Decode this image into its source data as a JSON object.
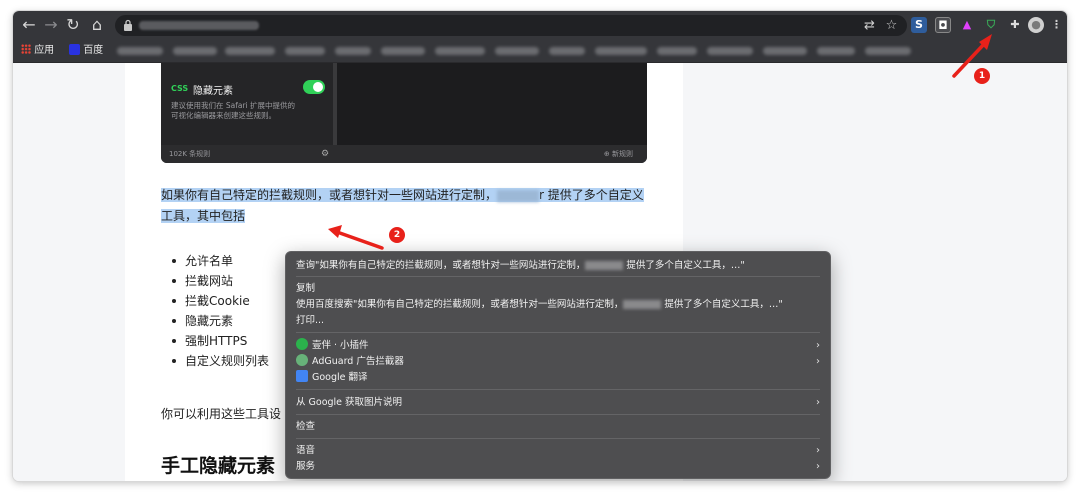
{
  "browser": {
    "extensions": [
      {
        "name": "s-extension-icon",
        "glyph": "S",
        "color": "#4a90d9"
      },
      {
        "name": "camera-extension-icon",
        "glyph": "◘",
        "color": "#5f6368"
      },
      {
        "name": "triangle-extension-icon",
        "glyph": "▲",
        "color": "#e040fb"
      },
      {
        "name": "adguard-extension-icon",
        "glyph": "⛉",
        "color": "#3aa757"
      },
      {
        "name": "puzzle-extension-icon",
        "glyph": "✚",
        "color": "#9aa0a6"
      }
    ],
    "bookmarks": {
      "apps_label": "应用",
      "baidu_label": "百度"
    }
  },
  "article": {
    "dark_panel": {
      "tag": "CSS",
      "title": "隐藏元素",
      "description": "建议使用我们在 Safari 扩展中提供的可视化编辑器来创建这些规则。",
      "count": "102K 条规则",
      "new_rule": "新规则"
    },
    "para1_part1": "如果你有自己特定的拦截规则，或者想针对一些网站进行定制，",
    "para1_part2": "r 提供了多个自定义工具，其中包括",
    "features": [
      "允许名单",
      "拦截网站",
      "拦截Cookie",
      "隐藏元素",
      "强制HTTPS",
      "自定义规则列表"
    ],
    "para2": "你可以利用这些工具设",
    "heading": "手工隐藏元素"
  },
  "context_menu": {
    "lookup_prefix": "查询\"如果你有自己特定的拦截规则，或者想针对一些网站进行定制，",
    "lookup_suffix": "提供了多个自定义工具，…\"",
    "copy": "复制",
    "baidu_search_prefix": "使用百度搜索\"如果你有自己特定的拦截规则，或者想针对一些网站进行定制，",
    "baidu_search_suffix": "提供了多个自定义工具，…\"",
    "print": "打印...",
    "ext1": "壹伴 · 小插件",
    "ext2": "AdGuard 广告拦截器",
    "ext3": "Google 翻译",
    "image_desc": "从 Google 获取图片说明",
    "inspect": "检查",
    "speech": "语音",
    "services": "服务"
  },
  "annotations": {
    "badge1": "1",
    "badge2": "2",
    "color": "#e8211a"
  }
}
